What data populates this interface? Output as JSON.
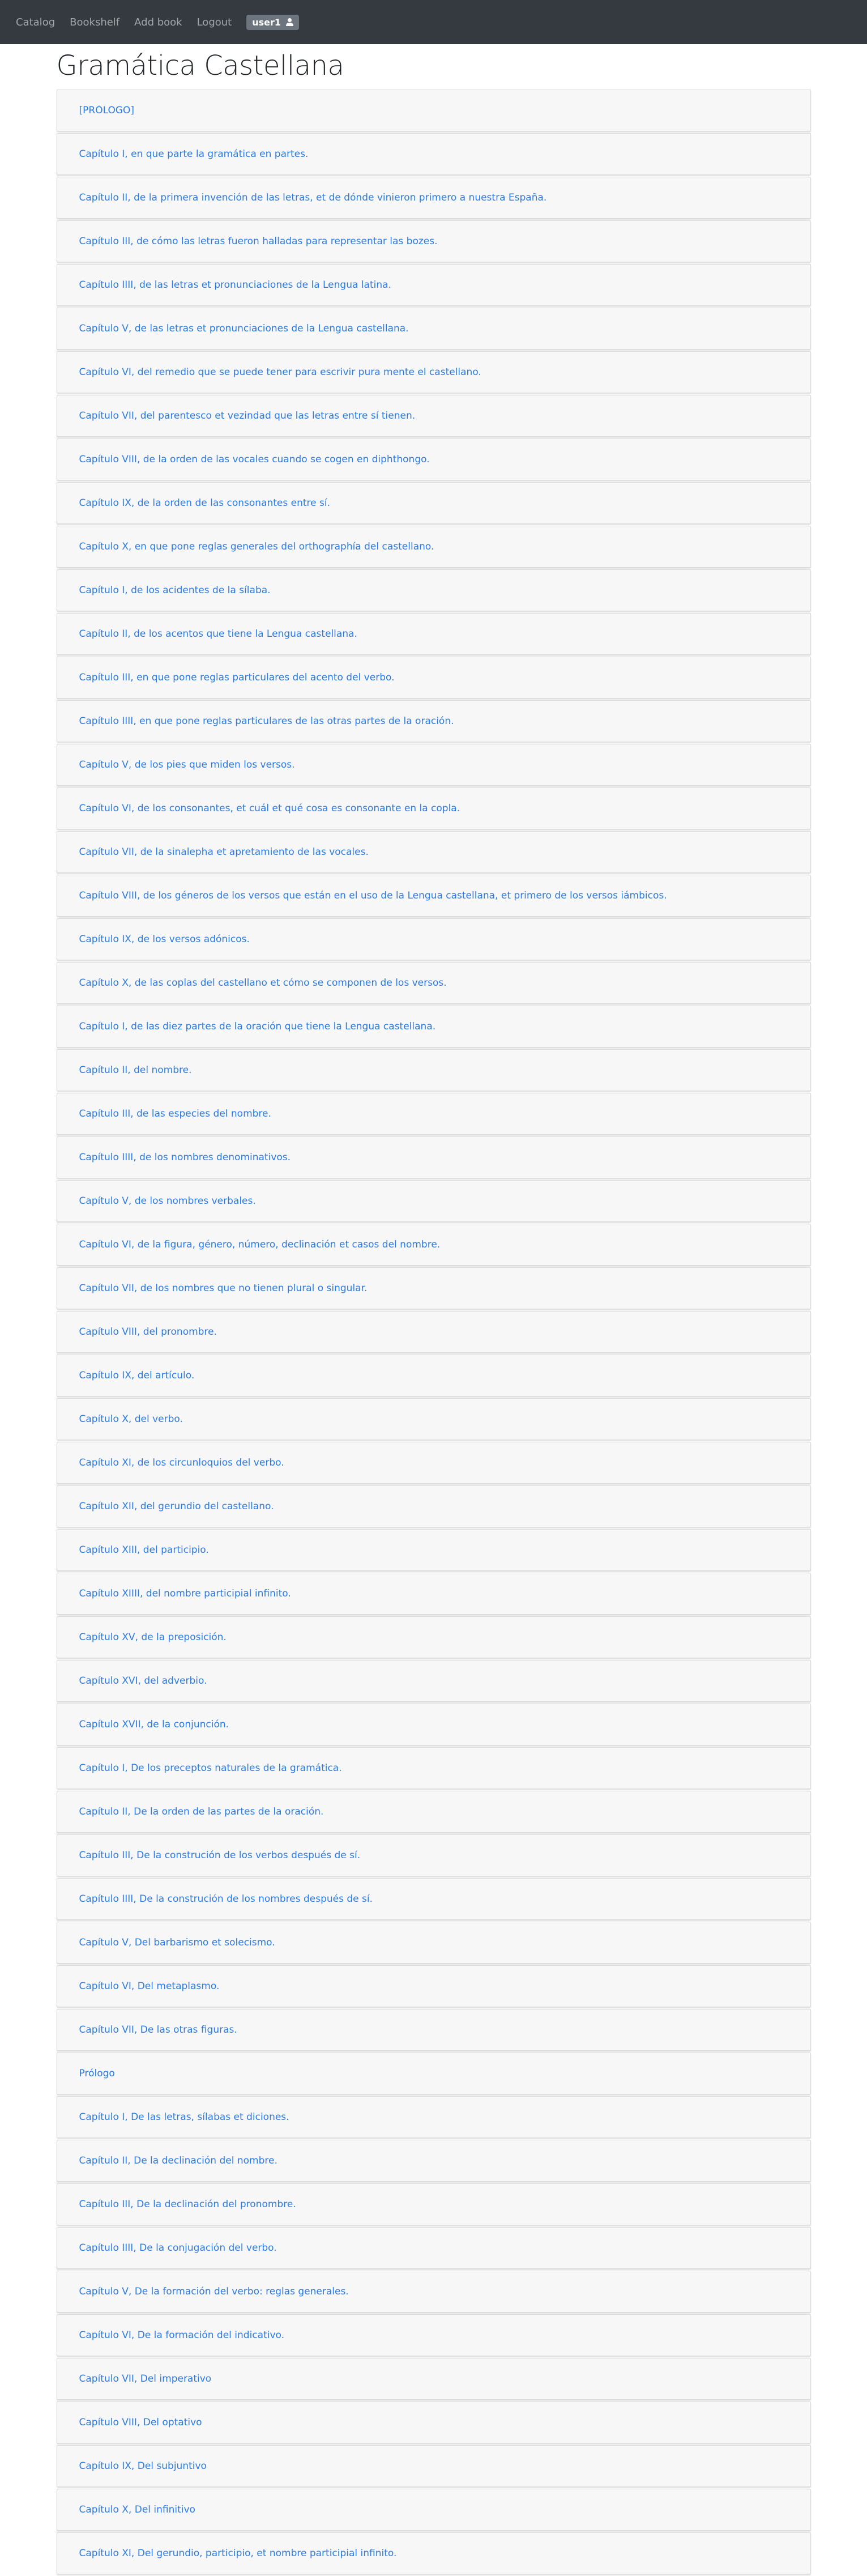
{
  "nav": {
    "links": [
      "Catalog",
      "Bookshelf",
      "Add book",
      "Logout"
    ],
    "user_label": "user1"
  },
  "book": {
    "title": "Gramática Castellana"
  },
  "chapters": [
    "[PRÓLOGO]",
    "Capítulo I, en que parte la gramática en partes.",
    "Capítulo II, de la primera invención de las letras, et de dónde vinieron primero a nuestra España.",
    "Capítulo III, de cómo las letras fueron halladas para representar las bozes.",
    "Capítulo IIII, de las letras et pronunciaciones de la Lengua latina.",
    "Capítulo V, de las letras et pronunciaciones de la Lengua castellana.",
    "Capítulo VI, del remedio que se puede tener para escrivir pura mente el castellano.",
    "Capítulo VII, del parentesco et vezindad que las letras entre sí tienen.",
    "Capítulo VIII, de la orden de las vocales cuando se cogen en diphthongo.",
    "Capítulo IX, de la orden de las consonantes entre sí.",
    "Capítulo X, en que pone reglas generales del orthographía del castellano.",
    "Capítulo I, de los acidentes de la sílaba.",
    "Capítulo II, de los acentos que tiene la Lengua castellana.",
    "Capítulo III, en que pone reglas particulares del acento del verbo.",
    "Capítulo IIII, en que pone reglas particulares de las otras partes de la oración.",
    "Capítulo V, de los pies que miden los versos.",
    "Capítulo VI, de los consonantes, et cuál et qué cosa es consonante en la copla.",
    "Capítulo VII, de la sinalepha et apretamiento de las vocales.",
    "Capítulo VIII, de los géneros de los versos que están en el uso de la Lengua castellana, et primero de los versos iámbicos.",
    "Capítulo IX, de los versos adónicos.",
    "Capítulo X, de las coplas del castellano et cómo se componen de los versos.",
    "Capítulo I, de las diez partes de la oración que tiene la Lengua castellana.",
    "Capítulo II, del nombre.",
    "Capítulo III, de las especies del nombre.",
    "Capítulo IIII, de los nombres denominativos.",
    "Capítulo V, de los nombres verbales.",
    "Capítulo VI, de la figura, género, número, declinación et casos del nombre.",
    "Capítulo VII, de los nombres que no tienen plural o singular.",
    "Capítulo VIII, del pronombre.",
    "Capítulo IX, del artículo.",
    "Capítulo X, del verbo.",
    "Capítulo XI, de los circunloquios del verbo.",
    "Capítulo XII, del gerundio del castellano.",
    "Capítulo XIII, del participio.",
    "Capítulo XIIII, del nombre participial infinito.",
    "Capítulo XV, de la preposición.",
    "Capítulo XVI, del adverbio.",
    "Capítulo XVII, de la conjunción.",
    "Capítulo I, De los preceptos naturales de la gramática.",
    "Capítulo II, De la orden de las partes de la oración.",
    "Capítulo III, De la construción de los verbos después de sí.",
    "Capítulo IIII, De la construción de los nombres después de sí.",
    "Capítulo V, Del barbarismo et solecismo.",
    "Capítulo VI, Del metaplasmo.",
    "Capítulo VII, De las otras figuras.",
    "Prólogo",
    "Capítulo I, De las letras, sílabas et diciones.",
    "Capítulo II, De la declinación del nombre.",
    "Capítulo III, De la declinación del pronombre.",
    "Capítulo IIII, De la conjugación del verbo.",
    "Capítulo V, De la formación del verbo: reglas generales.",
    "Capítulo VI, De la formación del indicativo.",
    "Capítulo VII, Del imperativo",
    "Capítulo VIII, Del optativo",
    "Capítulo IX, Del subjuntivo",
    "Capítulo X, Del infinitivo",
    "Capítulo XI, Del gerundio, participio, et nombre participial infinito."
  ]
}
